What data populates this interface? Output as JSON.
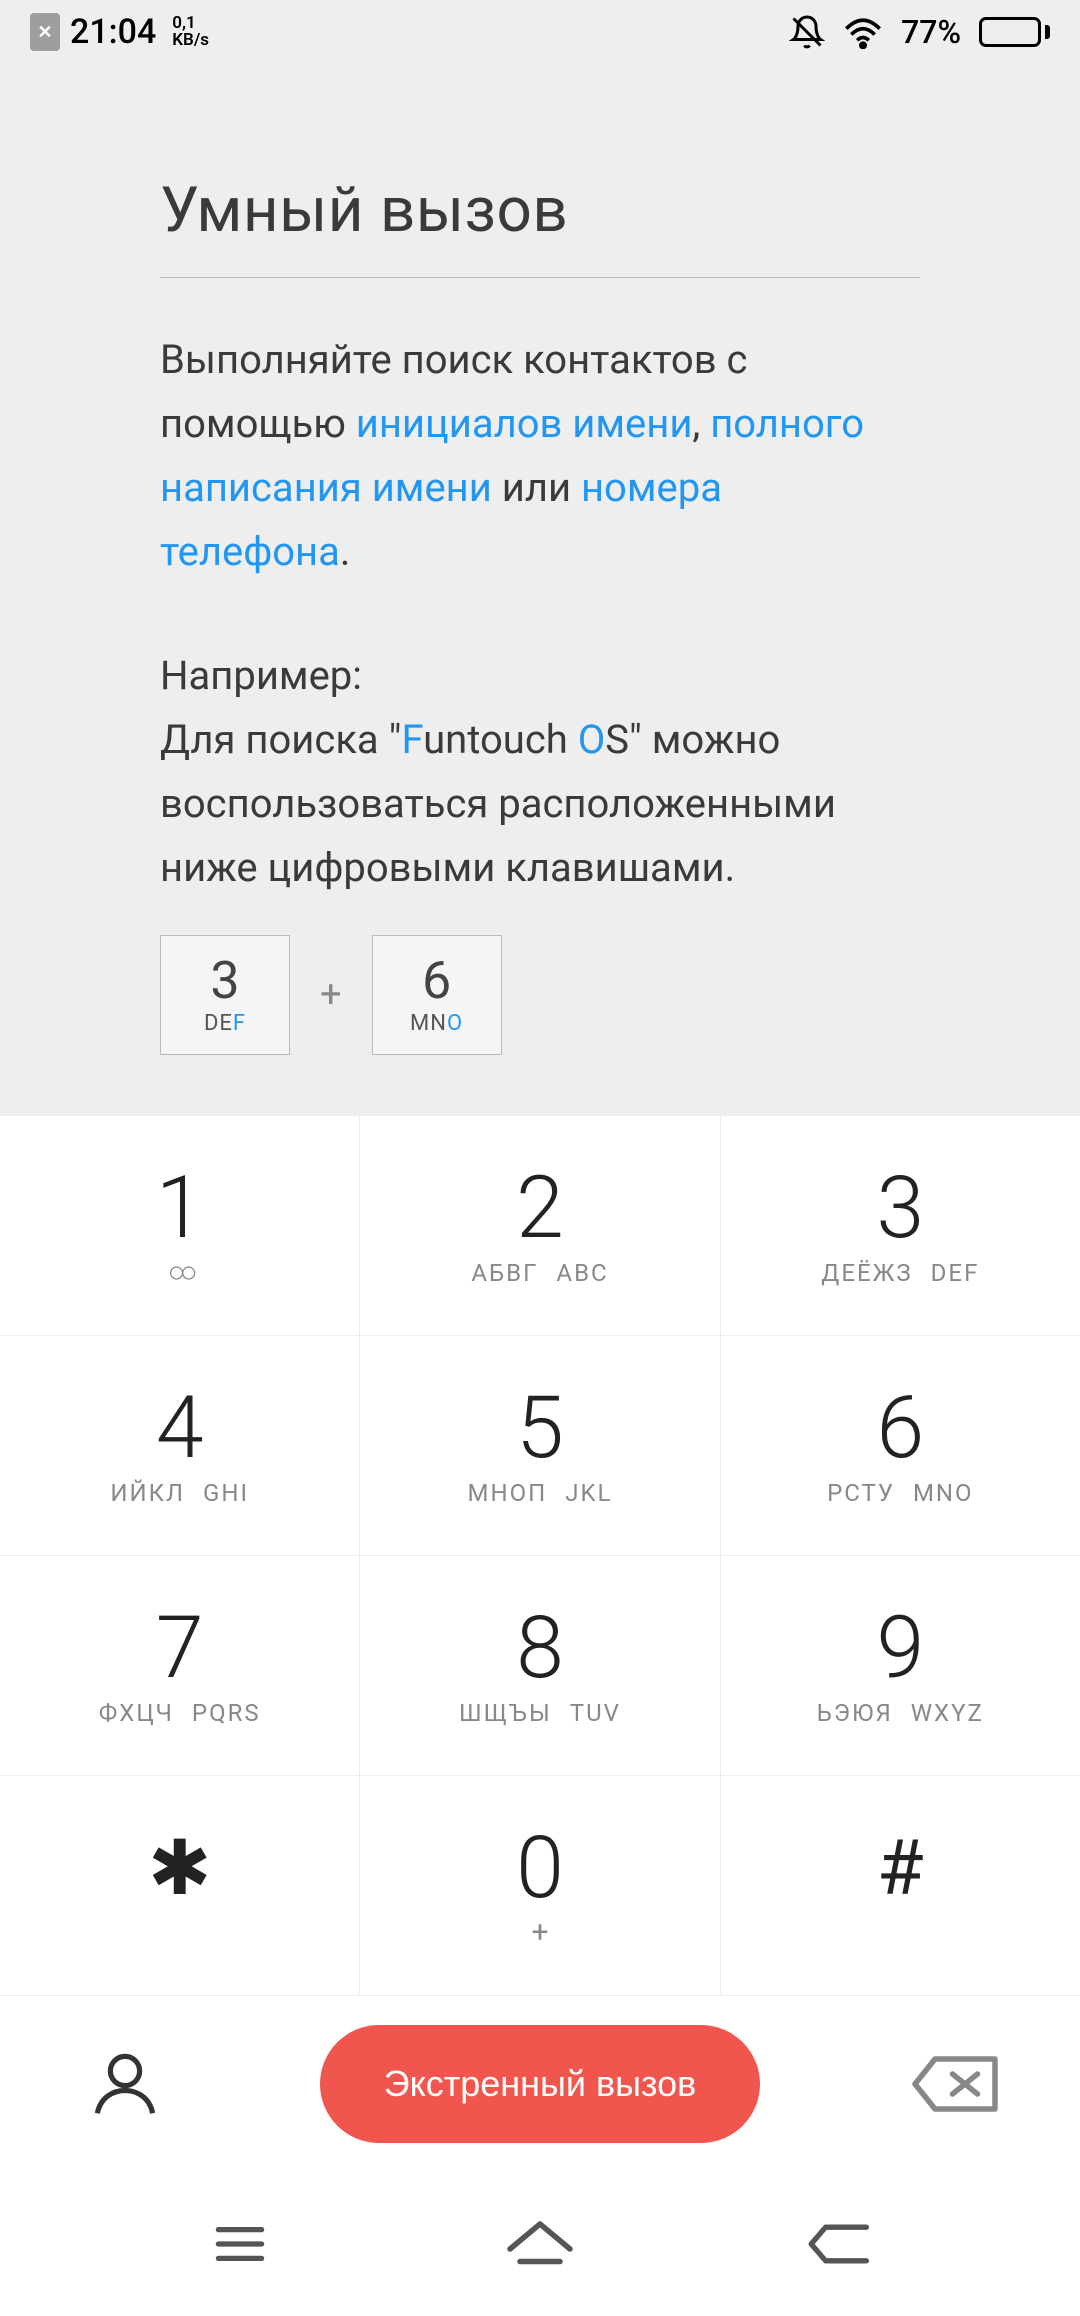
{
  "status": {
    "time": "21:04",
    "rate_top": "0,1",
    "rate_bottom": "KB/s",
    "battery_pct": "77%"
  },
  "info": {
    "title": "Умный вызов",
    "line1_a": "Выполняйте поиск контактов с помощью ",
    "link1": "инициалов имени",
    "sep1": ", ",
    "link2": "полного написания имени",
    "sep2": " или ",
    "link3": "номера телефона",
    "sep3": ".",
    "example_label": "Например:",
    "example_a": "Для поиска \"",
    "example_f": "F",
    "example_untouch": "untouch ",
    "example_o": "O",
    "example_s": "S",
    "example_b": "\" можно воспользоваться расположенными ниже цифровыми клавишами.",
    "key3_digit": "3",
    "key3_sub_de": "DE",
    "key3_sub_f": "F",
    "plus": "+",
    "key6_digit": "6",
    "key6_sub_mn": "MN",
    "key6_sub_o": "O"
  },
  "dialpad": {
    "keys": [
      {
        "digit": "1",
        "ru": "",
        "en": "",
        "vm": true
      },
      {
        "digit": "2",
        "ru": "АБВГ",
        "en": "ABC"
      },
      {
        "digit": "3",
        "ru": "ДЕЁЖЗ",
        "en": "DEF"
      },
      {
        "digit": "4",
        "ru": "ИЙКЛ",
        "en": "GHI"
      },
      {
        "digit": "5",
        "ru": "МНОП",
        "en": "JKL"
      },
      {
        "digit": "6",
        "ru": "РСТУ",
        "en": "MNO"
      },
      {
        "digit": "7",
        "ru": "ФХЦЧ",
        "en": "PQRS"
      },
      {
        "digit": "8",
        "ru": "ШЩЪЫ",
        "en": "TUV"
      },
      {
        "digit": "9",
        "ru": "ЬЭЮЯ",
        "en": "WXYZ"
      },
      {
        "digit": "✱",
        "ru": "",
        "en": "",
        "sym": true
      },
      {
        "digit": "0",
        "ru": "",
        "en": "",
        "plus": true
      },
      {
        "digit": "#",
        "ru": "",
        "en": "",
        "sym": true
      }
    ]
  },
  "actions": {
    "call_label": "Экстренный вызов"
  }
}
